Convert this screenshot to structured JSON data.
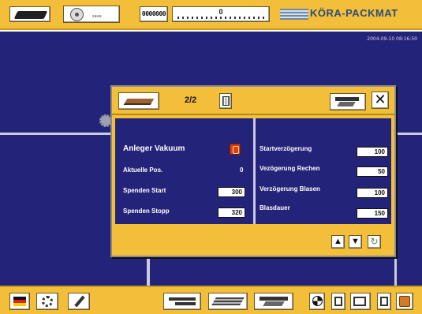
{
  "colors": {
    "toolbar": "#f3bf3a",
    "main_background": "#24237a",
    "pipe": "#c9cbe0",
    "indicator_active": "#e03c10",
    "brand_text": "#2b4d7a"
  },
  "header": {
    "icons": [
      "cassette-icon",
      "disk-icon",
      "counter-display",
      "progress-display"
    ],
    "disk_caption": "save",
    "counter": "0000000",
    "progress_value": "0",
    "brand": "KÖRA-PACKMAT"
  },
  "main": {
    "timestamp": "2004-09-10   08:16:50"
  },
  "dialog": {
    "page": "2/2",
    "close_label": "✕",
    "left_params": [
      {
        "label": "Anleger Vakuum",
        "value": ""
      },
      {
        "label": "Aktuelle Pos.",
        "value": "0"
      },
      {
        "label": "Spenden Start",
        "value": "300"
      },
      {
        "label": "Spenden Stopp",
        "value": "320"
      }
    ],
    "right_params": [
      {
        "label": "Startverzögerung",
        "value": "100"
      },
      {
        "label": "Vezögerung Rechen",
        "value": "50"
      },
      {
        "label": "Verzögerung Blasen",
        "value": "100"
      },
      {
        "label": "Blasdauer",
        "value": "150"
      }
    ],
    "nav_up": "▲",
    "nav_down": "▼",
    "nav_refresh": "↻"
  },
  "footer": {
    "icons": [
      "german-flag-icon",
      "settings-gear-icon",
      "wrench-icon",
      "feeder-icon",
      "stack-icon",
      "table-icon",
      "mode-icon",
      "view-single-icon",
      "view-double-icon",
      "view-alt-icon",
      "exit-icon"
    ]
  }
}
